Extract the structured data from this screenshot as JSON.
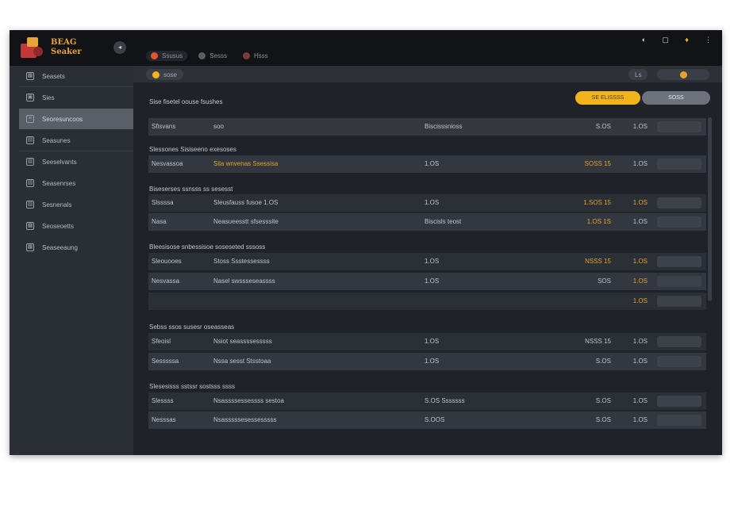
{
  "app": {
    "logo_line1": "BEAG",
    "logo_line2": "Seaker",
    "brand_color": "#e9a236"
  },
  "top_tabs": [
    {
      "label": "Ssusus",
      "dot": "#e2552d"
    },
    {
      "label": "Sesss",
      "dot": "#5b5f67"
    },
    {
      "label": "Hsss",
      "dot": "#7a3b3b"
    }
  ],
  "topright_icons": [
    "toggle-icon",
    "window-icon",
    "bell-icon",
    "more-icon"
  ],
  "sidebar": {
    "items": [
      {
        "label": "Seasets",
        "icon": "grid-icon"
      },
      {
        "label": "Sies",
        "icon": "box-icon"
      },
      {
        "label": "Seoresuncoos",
        "icon": "list-icon",
        "active": true
      },
      {
        "label": "Seasunes",
        "icon": "table-icon"
      },
      {
        "label": "Seeselvants",
        "icon": "chart-icon"
      },
      {
        "label": "Seasenrses",
        "icon": "doc-icon"
      },
      {
        "label": "Sesnenals",
        "icon": "folder-icon"
      },
      {
        "label": "Seoseoetts",
        "icon": "image-icon"
      },
      {
        "label": "Seaseeaung",
        "icon": "calendar-icon"
      }
    ]
  },
  "subbar": {
    "chip_label": "sose",
    "right_chip": "Ls"
  },
  "header": {
    "title": "Sise fisetel oouse fsushes",
    "primary_btn": "SE ELISSSS",
    "secondary_btn": "SOSS",
    "accent": "#f2b41a"
  },
  "header_row": {
    "c1": "Sfisvans",
    "c2": "soo",
    "c3": "Biscisssnioss",
    "c4": "S.OS",
    "c5": "1.OS"
  },
  "sections": [
    {
      "title": "Slessones Sisiseeno exesoses",
      "rows": [
        {
          "c1": "Nesvassoa",
          "c2": "Sila wnvenas Ssessisa",
          "c2y": true,
          "c3": "1.OS",
          "c4": "SOSS 15",
          "c4y": true,
          "c5": "1.OS"
        }
      ]
    },
    {
      "title": "Biseserses ssnsss ss sesesst",
      "rows": [
        {
          "c1": "Slssssa",
          "c2": "Sleusfauss fusoe 1.OS",
          "c3": "1.OS",
          "c4": "1.SOS 15",
          "c4y": true,
          "c5": "1.OS",
          "c5y": true
        },
        {
          "c1": "Nasa",
          "c2": "Neasueesstt sfsesssite",
          "c3": "Biscisls teost",
          "c4": "1.OS 1S",
          "c4y": true,
          "c5": "1.OS"
        }
      ]
    },
    {
      "title": "Bleesisose snbessisoe soseseted sssoss",
      "rows": [
        {
          "c1": "Sleouooes",
          "c2": "Stoss Ssstessessss",
          "c3": "1.OS",
          "c4": "NSSS 15",
          "c4y": true,
          "c5": "1.OS",
          "c5y": true
        },
        {
          "c1": "Nesvassa",
          "c2": "Nasel swssseseassss",
          "c3": "1.OS",
          "c4": "SOS",
          "c5": "1.OS",
          "c5y": true
        },
        {
          "c1": "",
          "c2": "",
          "c3": "",
          "c4": "",
          "c5": "1.OS",
          "c5y": true
        }
      ]
    },
    {
      "title": "Sebss ssos susesr oseasseas",
      "rows": [
        {
          "c1": "Sfeoisl",
          "c2": "Nsiot seassssesssss",
          "c3": "1.OS",
          "c4": "NSSS 15",
          "c5": "1.OS"
        },
        {
          "c1": "Sesssssa",
          "c2": "Nssa sesst Stsstoaa",
          "c3": "1.OS",
          "c4": "S.OS",
          "c5": "1.OS"
        }
      ]
    },
    {
      "title": "Slesesisss sstssr sostsss ssss",
      "rows": [
        {
          "c1": "Slessss",
          "c2": "Nsassssessessss sestoa",
          "c3": "S.OS Sssssss",
          "c4": "S.OS",
          "c5": "1.OS"
        },
        {
          "c1": "Nesssas",
          "c2": "Nsasssssesessesssss",
          "c3": "S.OOS",
          "c4": "S.OS",
          "c5": "1.OS"
        }
      ]
    }
  ]
}
